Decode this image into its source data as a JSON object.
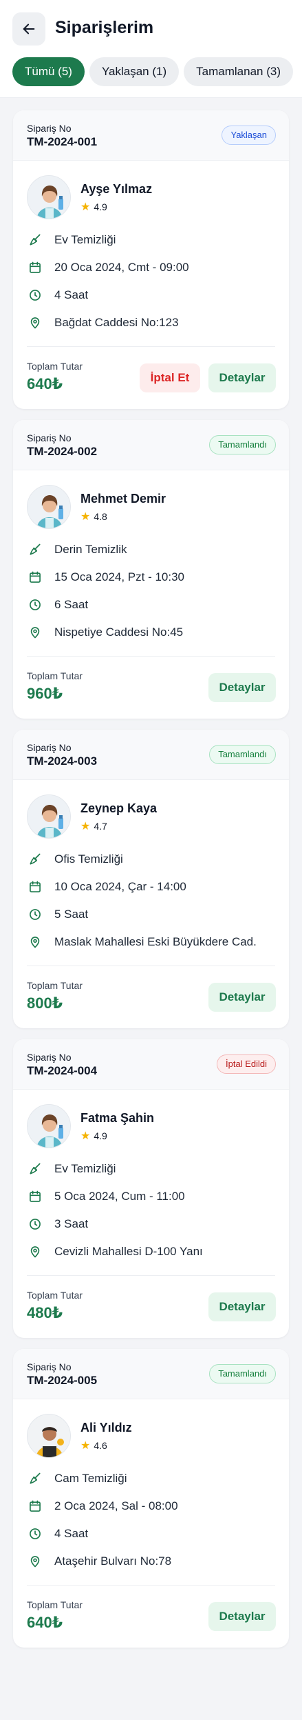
{
  "header": {
    "title": "Siparişlerim",
    "back_icon": "arrow-left-icon"
  },
  "tabs": [
    {
      "label": "Tümü (5)",
      "active": true
    },
    {
      "label": "Yaklaşan (1)",
      "active": false
    },
    {
      "label": "Tamamlanan (3)",
      "active": false
    }
  ],
  "labels": {
    "order_no": "Sipariş No",
    "total": "Toplam Tutar",
    "cancel_button": "İptal Et",
    "details_button": "Detaylar"
  },
  "colors": {
    "brand_green": "#1d7a4d",
    "star": "#f5b301",
    "cancel_red": "#dc2626"
  },
  "orders": [
    {
      "order_no": "TM-2024-001",
      "status": "Yaklaşan",
      "status_type": "pending",
      "name": "Ayşe Yılmaz",
      "rating": "4.9",
      "service": "Ev Temizliği",
      "date": "20 Oca 2024, Cmt - 09:00",
      "duration": "4 Saat",
      "address": "Bağdat Caddesi No:123",
      "total": "640₺",
      "cancellable": true,
      "avatar": "female-cleaner"
    },
    {
      "order_no": "TM-2024-002",
      "status": "Tamamlandı",
      "status_type": "done",
      "name": "Mehmet Demir",
      "rating": "4.8",
      "service": "Derin Temizlik",
      "date": "15 Oca 2024, Pzt - 10:30",
      "duration": "6 Saat",
      "address": "Nispetiye Caddesi No:45",
      "total": "960₺",
      "cancellable": false,
      "avatar": "female-cleaner"
    },
    {
      "order_no": "TM-2024-003",
      "status": "Tamamlandı",
      "status_type": "done",
      "name": "Zeynep Kaya",
      "rating": "4.7",
      "service": "Ofis Temizliği",
      "date": "10 Oca 2024, Çar - 14:00",
      "duration": "5 Saat",
      "address": "Maslak Mahallesi Eski Büyükdere Cad.",
      "total": "800₺",
      "cancellable": false,
      "avatar": "female-cleaner"
    },
    {
      "order_no": "TM-2024-004",
      "status": "İptal Edildi",
      "status_type": "cancel",
      "name": "Fatma Şahin",
      "rating": "4.9",
      "service": "Ev Temizliği",
      "date": "5 Oca 2024, Cum - 11:00",
      "duration": "3 Saat",
      "address": "Cevizli Mahallesi D-100 Yanı",
      "total": "480₺",
      "cancellable": false,
      "avatar": "female-cleaner"
    },
    {
      "order_no": "TM-2024-005",
      "status": "Tamamlandı",
      "status_type": "done",
      "name": "Ali Yıldız",
      "rating": "4.6",
      "service": "Cam Temizliği",
      "date": "2 Oca 2024, Sal - 08:00",
      "duration": "4 Saat",
      "address": "Ataşehir Bulvarı No:78",
      "total": "640₺",
      "cancellable": false,
      "avatar": "male-cleaner"
    }
  ]
}
